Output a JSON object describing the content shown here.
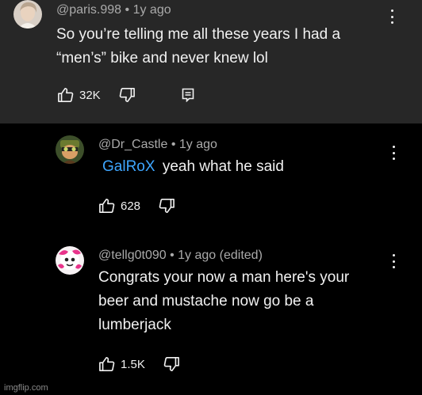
{
  "comments": [
    {
      "handle": "@paris.998",
      "sep": "•",
      "time": "1y ago",
      "edited": "",
      "mention": "",
      "lines": [
        "So you’re telling me all these years I had a",
        "“men’s” bike and never knew lol"
      ],
      "likes": "32K",
      "avatar_icon": "profile-photo-icon",
      "more_icon": "more-vert-icon"
    },
    {
      "handle": "@Dr_Castle",
      "sep": "•",
      "time": "1y ago",
      "edited": "",
      "mention": "GalRoX",
      "lines": [
        "yeah what he said"
      ],
      "likes": "628",
      "avatar_icon": "cartoon-avatar-icon",
      "more_icon": "more-vert-icon"
    },
    {
      "handle": "@tellg0t090",
      "sep": "•",
      "time": "1y ago",
      "edited": "(edited)",
      "mention": "",
      "lines": [
        "Congrats your now a man here's your",
        "beer and mustache now go be a",
        "lumberjack"
      ],
      "likes": "1.5K",
      "avatar_icon": "pink-cartoon-avatar-icon",
      "more_icon": "more-vert-icon"
    }
  ],
  "icons": {
    "like": "thumb-up-icon",
    "dislike": "thumb-down-icon",
    "reply": "reply-icon"
  },
  "colors": {
    "top_bg": "#272727",
    "bottom_bg": "#000000",
    "text": "#f1f1f1",
    "meta": "#aaaaaa",
    "mention": "#3ea6ff"
  },
  "watermark": "imgflip.com"
}
